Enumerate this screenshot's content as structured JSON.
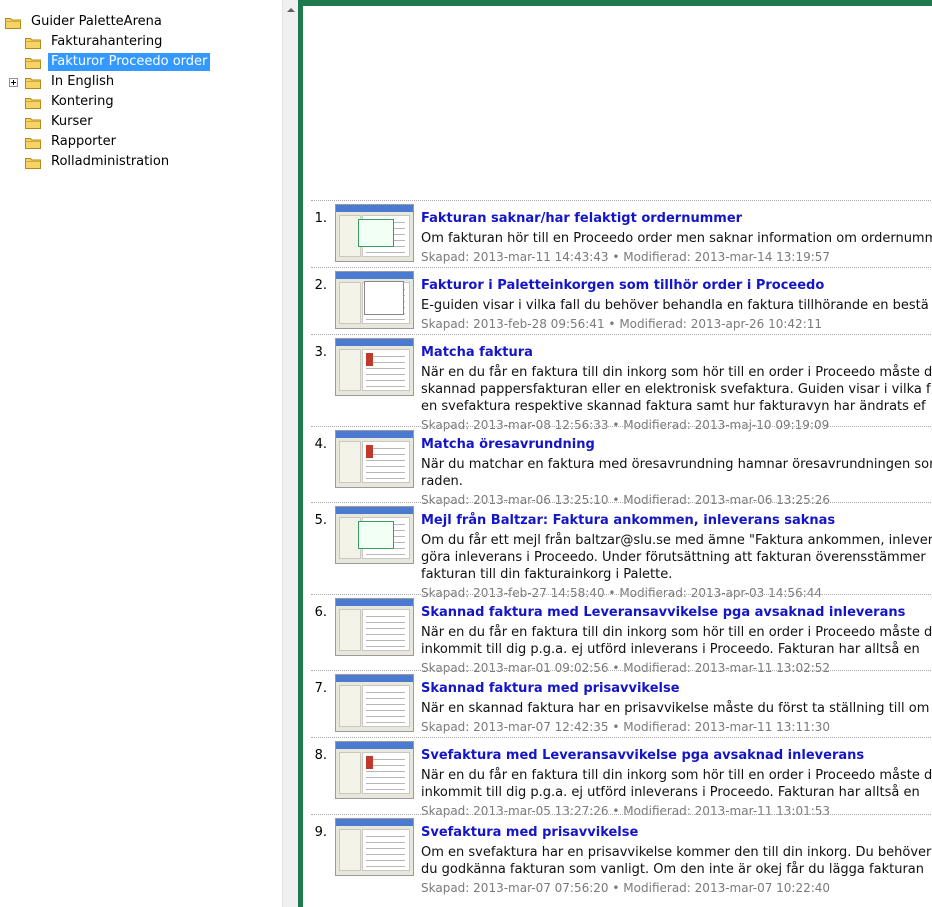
{
  "tree": {
    "root": "Guider PaletteArena",
    "items": [
      {
        "label": "Fakturahantering"
      },
      {
        "label": "Fakturor Proceedo order"
      },
      {
        "label": "In English"
      },
      {
        "label": "Kontering"
      },
      {
        "label": "Kurser"
      },
      {
        "label": "Rapporter"
      },
      {
        "label": "Rolladministration"
      }
    ]
  },
  "labels": {
    "created": "Skapad:",
    "modified": "Modifierad:",
    "separator": "•"
  },
  "guides": [
    {
      "num": "1.",
      "title": "Fakturan saknar/har felaktigt ordernummer",
      "desc": [
        "Om fakturan hör till en Proceedo order men saknar information om ordernumm"
      ],
      "created": "2013-mar-11 14:43:43",
      "modified": "2013-mar-14 13:19:57"
    },
    {
      "num": "2.",
      "title": "Fakturor i Paletteinkorgen som tillhör order i Proceedo",
      "desc": [
        "E-guiden visar i vilka fall du behöver behandla en faktura tillhörande en bestä"
      ],
      "created": "2013-feb-28 09:56:41",
      "modified": "2013-apr-26 10:42:11"
    },
    {
      "num": "3.",
      "title": "Matcha faktura",
      "desc": [
        "När en du får en faktura till din inkorg som hör till en order i Proceedo måste d",
        "skannad pappersfakturan eller en elektronisk svefaktura. Guiden visar i vilka f",
        "en svefaktura respektive skannad faktura samt hur fakturavyn har ändrats ef"
      ],
      "created": "2013-mar-08 12:56:33",
      "modified": "2013-maj-10 09:19:09"
    },
    {
      "num": "4.",
      "title": "Matcha öresavrundning",
      "desc": [
        "När du matchar en faktura med öresavrundning hamnar öresavrundningen son",
        "raden."
      ],
      "created": "2013-mar-06 13:25:10",
      "modified": "2013-mar-06 13:25:26"
    },
    {
      "num": "5.",
      "title": "Mejl från Baltzar: Faktura ankommen, inleverans saknas",
      "desc": [
        "Om du får ett mejl från baltzar@slu.se med ämne \"Faktura ankommen, inlever",
        "göra inleverans i Proceedo. Under förutsättning att fakturan överensstämmer",
        "fakturan till din fakturainkorg i Palette."
      ],
      "created": "2013-feb-27 14:58:40",
      "modified": "2013-apr-03 14:56:44"
    },
    {
      "num": "6.",
      "title": "Skannad faktura med Leveransavvikelse pga avsaknad inleverans",
      "desc": [
        "När en du får en faktura till din inkorg som hör till en order i Proceedo måste d",
        "inkommit till dig p.g.a. ej utförd inleverans i Proceedo. Fakturan har alltså en"
      ],
      "created": "2013-mar-01 09:02:56",
      "modified": "2013-mar-11 13:02:52"
    },
    {
      "num": "7.",
      "title": "Skannad faktura med prisavvikelse",
      "desc": [
        "När en skannad faktura har en prisavvikelse måste du först ta ställning till om"
      ],
      "created": "2013-mar-07 12:42:35",
      "modified": "2013-mar-11 13:11:30"
    },
    {
      "num": "8.",
      "title": "Svefaktura med Leveransavvikelse pga avsaknad inleverans",
      "desc": [
        "När en du får en faktura till din inkorg som hör till en order i Proceedo måste d",
        "inkommit till dig p.g.a. ej utförd inleverans i Proceedo. Fakturan har alltså en"
      ],
      "created": "2013-mar-05 13:27:26",
      "modified": "2013-mar-11 13:01:53"
    },
    {
      "num": "9.",
      "title": "Svefaktura med prisavvikelse",
      "desc": [
        "Om en svefaktura har en prisavvikelse kommer den till din inkorg. Du behöver",
        "du godkänna fakturan som vanligt. Om den inte är okej får du lägga fakturan"
      ],
      "created": "2013-mar-07 07:56:20",
      "modified": "2013-mar-07 10:22:40"
    }
  ]
}
